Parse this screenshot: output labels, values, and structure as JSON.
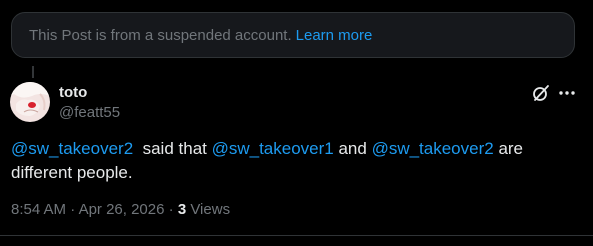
{
  "notice": {
    "text": "This Post is from a suspended account.",
    "link_label": "Learn more"
  },
  "post": {
    "author_name": "toto",
    "author_handle": "@featt55",
    "text": {
      "mention1": "@sw_takeover2",
      "part1": "  said that ",
      "mention2": "@sw_takeover1",
      "part2": " and ",
      "mention3": "@sw_takeover2",
      "part3": " are different people."
    },
    "time": "8:54 AM",
    "separator1": " · ",
    "date": "Apr 26, 2026",
    "separator2": " · ",
    "views_count": "3",
    "views_label": " Views"
  },
  "icons": {
    "grok": "grok-icon",
    "more": "more-icon"
  },
  "colors": {
    "accent": "#1d9bf0",
    "muted": "#71767b",
    "background": "#000000"
  }
}
